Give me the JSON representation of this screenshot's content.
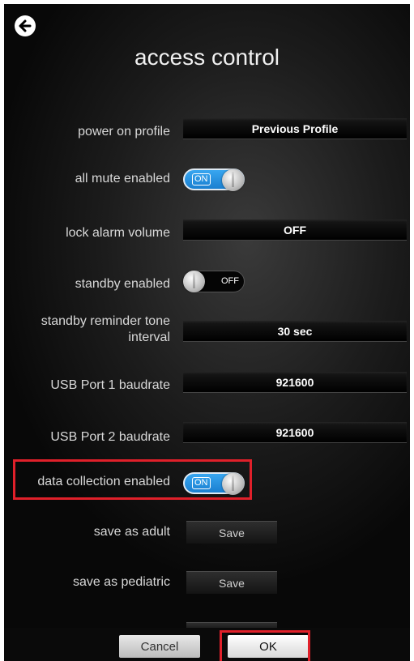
{
  "header": {
    "back_icon": "arrow-left-circle-icon",
    "title": "access control"
  },
  "settings": {
    "power_on_profile": {
      "label": "power on profile",
      "value": "Previous Profile"
    },
    "all_mute_enabled": {
      "label": "all mute enabled",
      "state": "ON"
    },
    "lock_alarm_volume": {
      "label": "lock alarm volume",
      "value": "OFF"
    },
    "standby_enabled": {
      "label": "standby enabled",
      "state": "OFF"
    },
    "standby_reminder": {
      "label_line1": "standby reminder tone",
      "label_line2": "interval",
      "value": "30 sec"
    },
    "usb1_baudrate": {
      "label": "USB Port 1 baudrate",
      "value": "921600"
    },
    "usb2_baudrate": {
      "label": "USB Port 2 baudrate",
      "value": "921600"
    },
    "data_collection_enabled": {
      "label": "data collection enabled",
      "state": "ON"
    },
    "save_as_adult": {
      "label": "save as adult",
      "button": "Save"
    },
    "save_as_pediatric": {
      "label": "save as pediatric",
      "button": "Save"
    }
  },
  "footer": {
    "cancel_label": "Cancel",
    "ok_label": "OK"
  },
  "colors": {
    "highlight": "#e0202a",
    "toggle_on": "#2a95e6"
  }
}
